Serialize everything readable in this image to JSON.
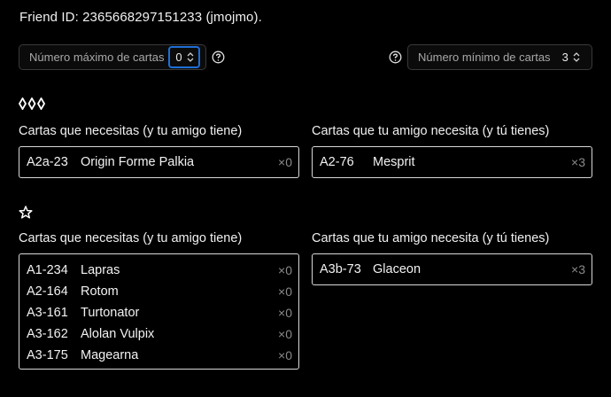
{
  "friend_id_text": "Friend ID: 2365668297151233 (jmojmo).",
  "filters": {
    "max_label": "Número máximo de cartas",
    "max_value": "0",
    "min_label": "Número mínimo de cartas",
    "min_value": "3"
  },
  "sections": [
    {
      "rarity_icon": "three-diamonds-icon",
      "left_title": "Cartas que necesitas (y tu amigo tiene)",
      "right_title": "Cartas que tu amigo necesita (y tú tienes)",
      "left_cards": [
        {
          "code": "A2a-23",
          "name": "Origin Forme Palkia",
          "qty": "×0"
        }
      ],
      "right_cards": [
        {
          "code": "A2-76",
          "name": "Mesprit",
          "qty": "×3"
        }
      ]
    },
    {
      "rarity_icon": "star-icon",
      "left_title": "Cartas que necesitas (y tu amigo tiene)",
      "right_title": "Cartas que tu amigo necesita (y tú tienes)",
      "left_cards": [
        {
          "code": "A1-234",
          "name": "Lapras",
          "qty": "×0"
        },
        {
          "code": "A2-164",
          "name": "Rotom",
          "qty": "×0"
        },
        {
          "code": "A3-161",
          "name": "Turtonator",
          "qty": "×0"
        },
        {
          "code": "A3-162",
          "name": "Alolan Vulpix",
          "qty": "×0"
        },
        {
          "code": "A3-175",
          "name": "Magearna",
          "qty": "×0"
        }
      ],
      "right_cards": [
        {
          "code": "A3b-73",
          "name": "Glaceon",
          "qty": "×3"
        }
      ]
    }
  ]
}
